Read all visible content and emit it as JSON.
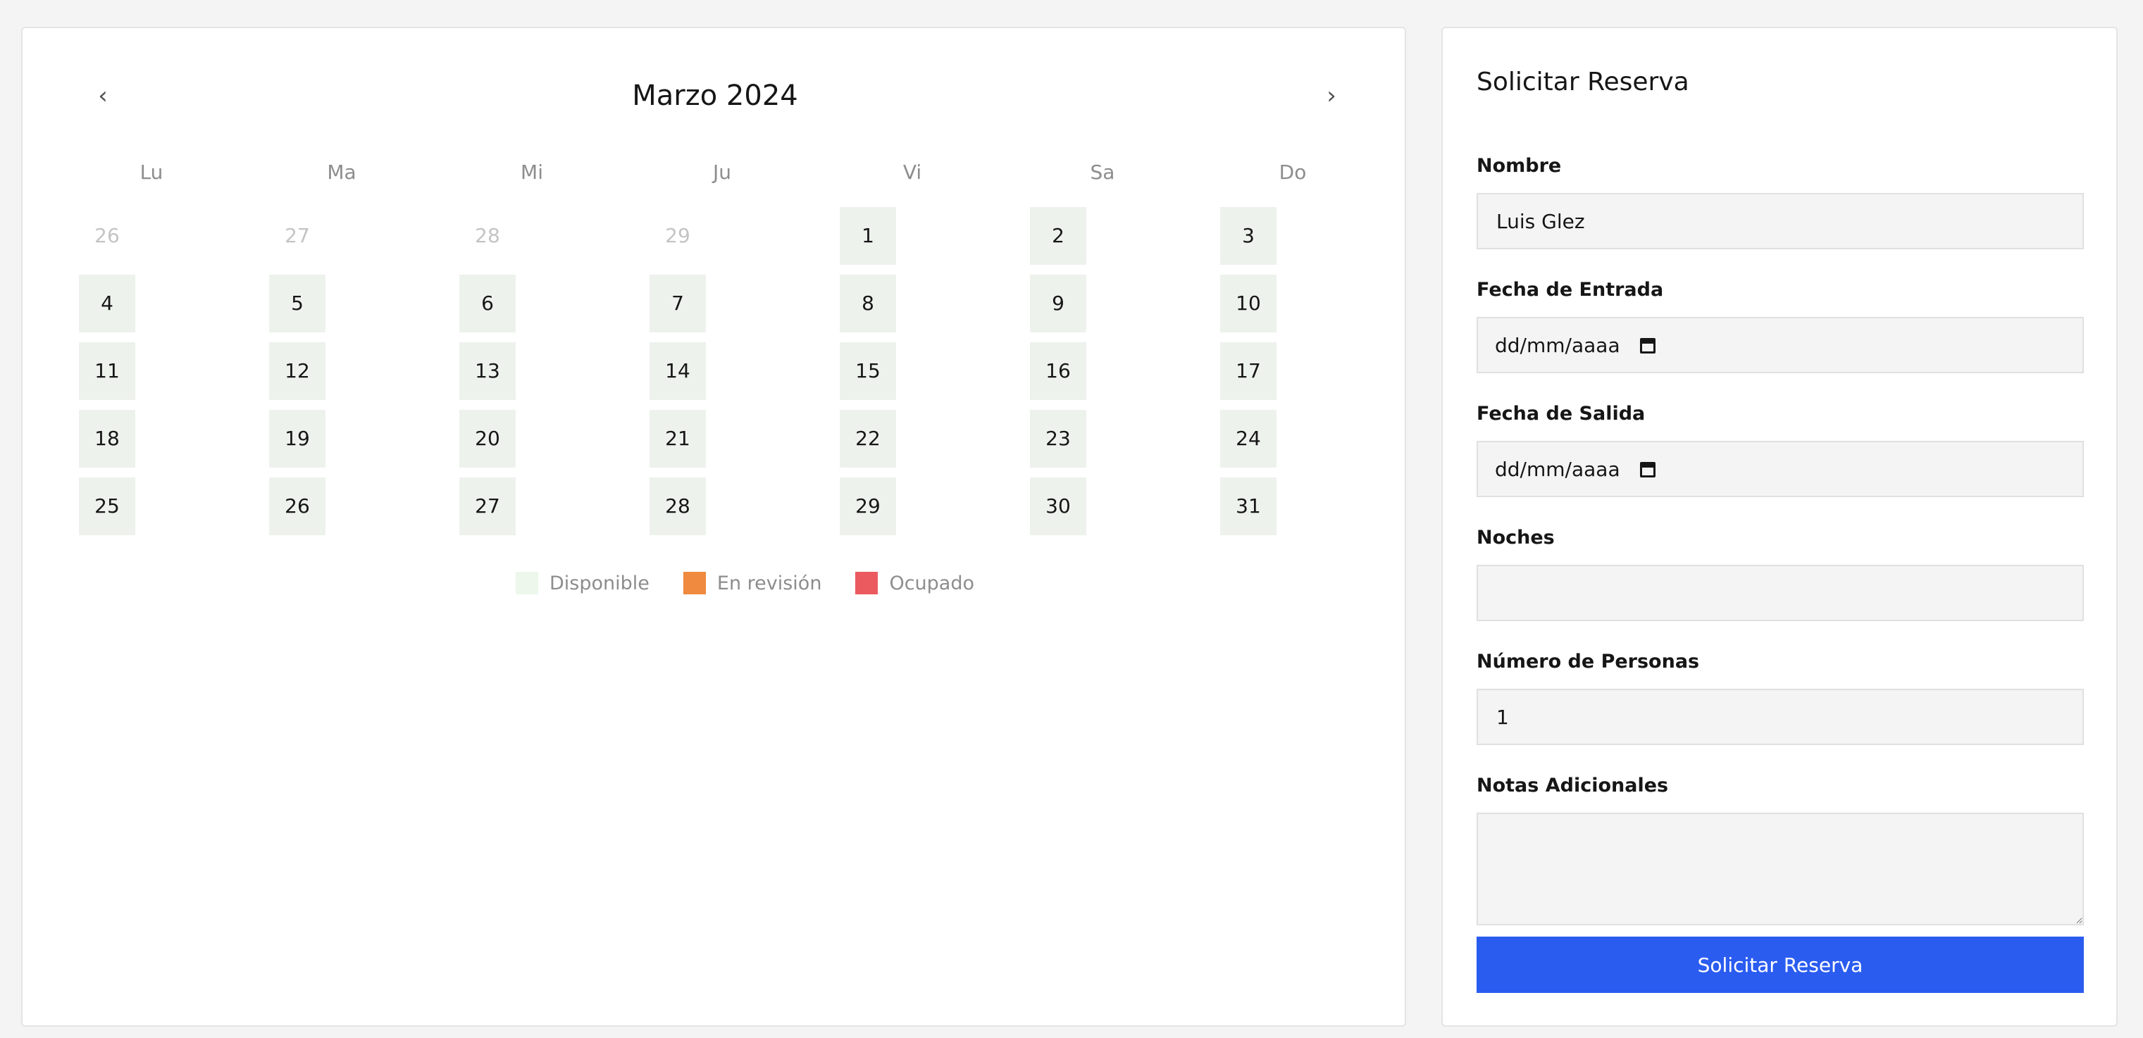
{
  "calendar": {
    "month_label": "Marzo 2024",
    "prev_icon": "chevron-left-icon",
    "next_icon": "chevron-right-icon",
    "weekdays": [
      "Lu",
      "Ma",
      "Mi",
      "Ju",
      "Vi",
      "Sa",
      "Do"
    ],
    "weeks": [
      [
        {
          "day": "26",
          "muted": true
        },
        {
          "day": "27",
          "muted": true
        },
        {
          "day": "28",
          "muted": true
        },
        {
          "day": "29",
          "muted": true
        },
        {
          "day": "1"
        },
        {
          "day": "2"
        },
        {
          "day": "3"
        }
      ],
      [
        {
          "day": "4"
        },
        {
          "day": "5"
        },
        {
          "day": "6"
        },
        {
          "day": "7"
        },
        {
          "day": "8"
        },
        {
          "day": "9"
        },
        {
          "day": "10"
        }
      ],
      [
        {
          "day": "11"
        },
        {
          "day": "12"
        },
        {
          "day": "13"
        },
        {
          "day": "14"
        },
        {
          "day": "15"
        },
        {
          "day": "16"
        },
        {
          "day": "17"
        }
      ],
      [
        {
          "day": "18"
        },
        {
          "day": "19"
        },
        {
          "day": "20"
        },
        {
          "day": "21"
        },
        {
          "day": "22"
        },
        {
          "day": "23"
        },
        {
          "day": "24"
        }
      ],
      [
        {
          "day": "25"
        },
        {
          "day": "26"
        },
        {
          "day": "27"
        },
        {
          "day": "28"
        },
        {
          "day": "29"
        },
        {
          "day": "30"
        },
        {
          "day": "31"
        }
      ]
    ],
    "legend": [
      {
        "label": "Disponible",
        "color": "#edf7ec"
      },
      {
        "label": "En revisión",
        "color": "#ef8a3e"
      },
      {
        "label": "Ocupado",
        "color": "#ea5a5e"
      }
    ]
  },
  "form": {
    "title": "Solicitar Reserva",
    "name_label": "Nombre",
    "name_value": "Luis Glez",
    "checkin_label": "Fecha de Entrada",
    "checkin_value": "dd/mm/aaaa",
    "checkout_label": "Fecha de Salida",
    "checkout_value": "dd/mm/aaaa",
    "nights_label": "Noches",
    "nights_value": "",
    "people_label": "Número de Personas",
    "people_value": "1",
    "notes_label": "Notas Adicionales",
    "notes_value": "",
    "submit_label": "Solicitar Reserva"
  },
  "colors": {
    "available_cell": "#edf2ec",
    "primary_button": "#2a5cf0"
  }
}
